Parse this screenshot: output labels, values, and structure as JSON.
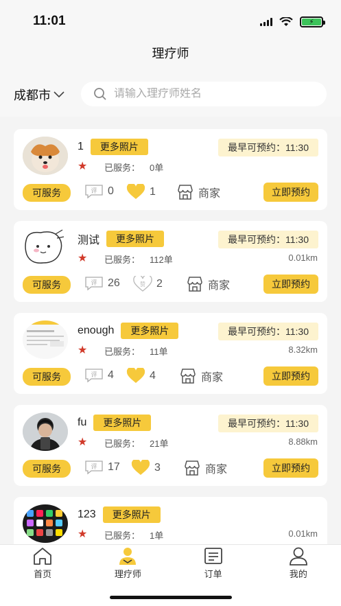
{
  "status": {
    "time": "11:01"
  },
  "nav": {
    "title": "理疗师"
  },
  "city": {
    "label": "成都市"
  },
  "search": {
    "placeholder": "请输入理疗师姓名"
  },
  "therapists": [
    {
      "name": "1",
      "more_label": "更多照片",
      "earliest": "最早可预约：11:30",
      "served_label": "已服务：",
      "served_count": "0单",
      "distance": "",
      "status": "可服务",
      "comments": "0",
      "likes": "1",
      "liked": true,
      "merchant": "商家",
      "book": "立即预约"
    },
    {
      "name": "测试",
      "more_label": "更多照片",
      "earliest": "最早可预约：11:30",
      "served_label": "已服务：",
      "served_count": "112单",
      "distance": "0.01km",
      "status": "可服务",
      "comments": "26",
      "likes": "2",
      "liked": false,
      "merchant": "商家",
      "book": "立即预约"
    },
    {
      "name": "enough",
      "more_label": "更多照片",
      "earliest": "最早可预约：11:30",
      "served_label": "已服务：",
      "served_count": "11单",
      "distance": "8.32km",
      "status": "可服务",
      "comments": "4",
      "likes": "4",
      "liked": true,
      "merchant": "商家",
      "book": "立即预约"
    },
    {
      "name": "fu",
      "more_label": "更多照片",
      "earliest": "最早可预约：11:30",
      "served_label": "已服务：",
      "served_count": "21单",
      "distance": "8.88km",
      "status": "可服务",
      "comments": "17",
      "likes": "3",
      "liked": true,
      "merchant": "商家",
      "book": "立即预约"
    },
    {
      "name": "123",
      "more_label": "更多照片",
      "earliest": "",
      "served_label": "已服务：",
      "served_count": "1单",
      "distance": "0.01km",
      "status": "",
      "comments": "",
      "likes": "",
      "liked": false,
      "merchant": "",
      "book": ""
    }
  ],
  "comment_icon_char": "评",
  "unliked_icon_char": "赞",
  "tabs": [
    {
      "label": "首页",
      "icon": "home-icon"
    },
    {
      "label": "理疗师",
      "icon": "therapist-icon",
      "active": true
    },
    {
      "label": "订单",
      "icon": "order-icon"
    },
    {
      "label": "我的",
      "icon": "profile-icon"
    }
  ],
  "colors": {
    "accent": "#f6c93b",
    "star": "#d13a2a",
    "badge_bg": "#fdf3cf"
  }
}
